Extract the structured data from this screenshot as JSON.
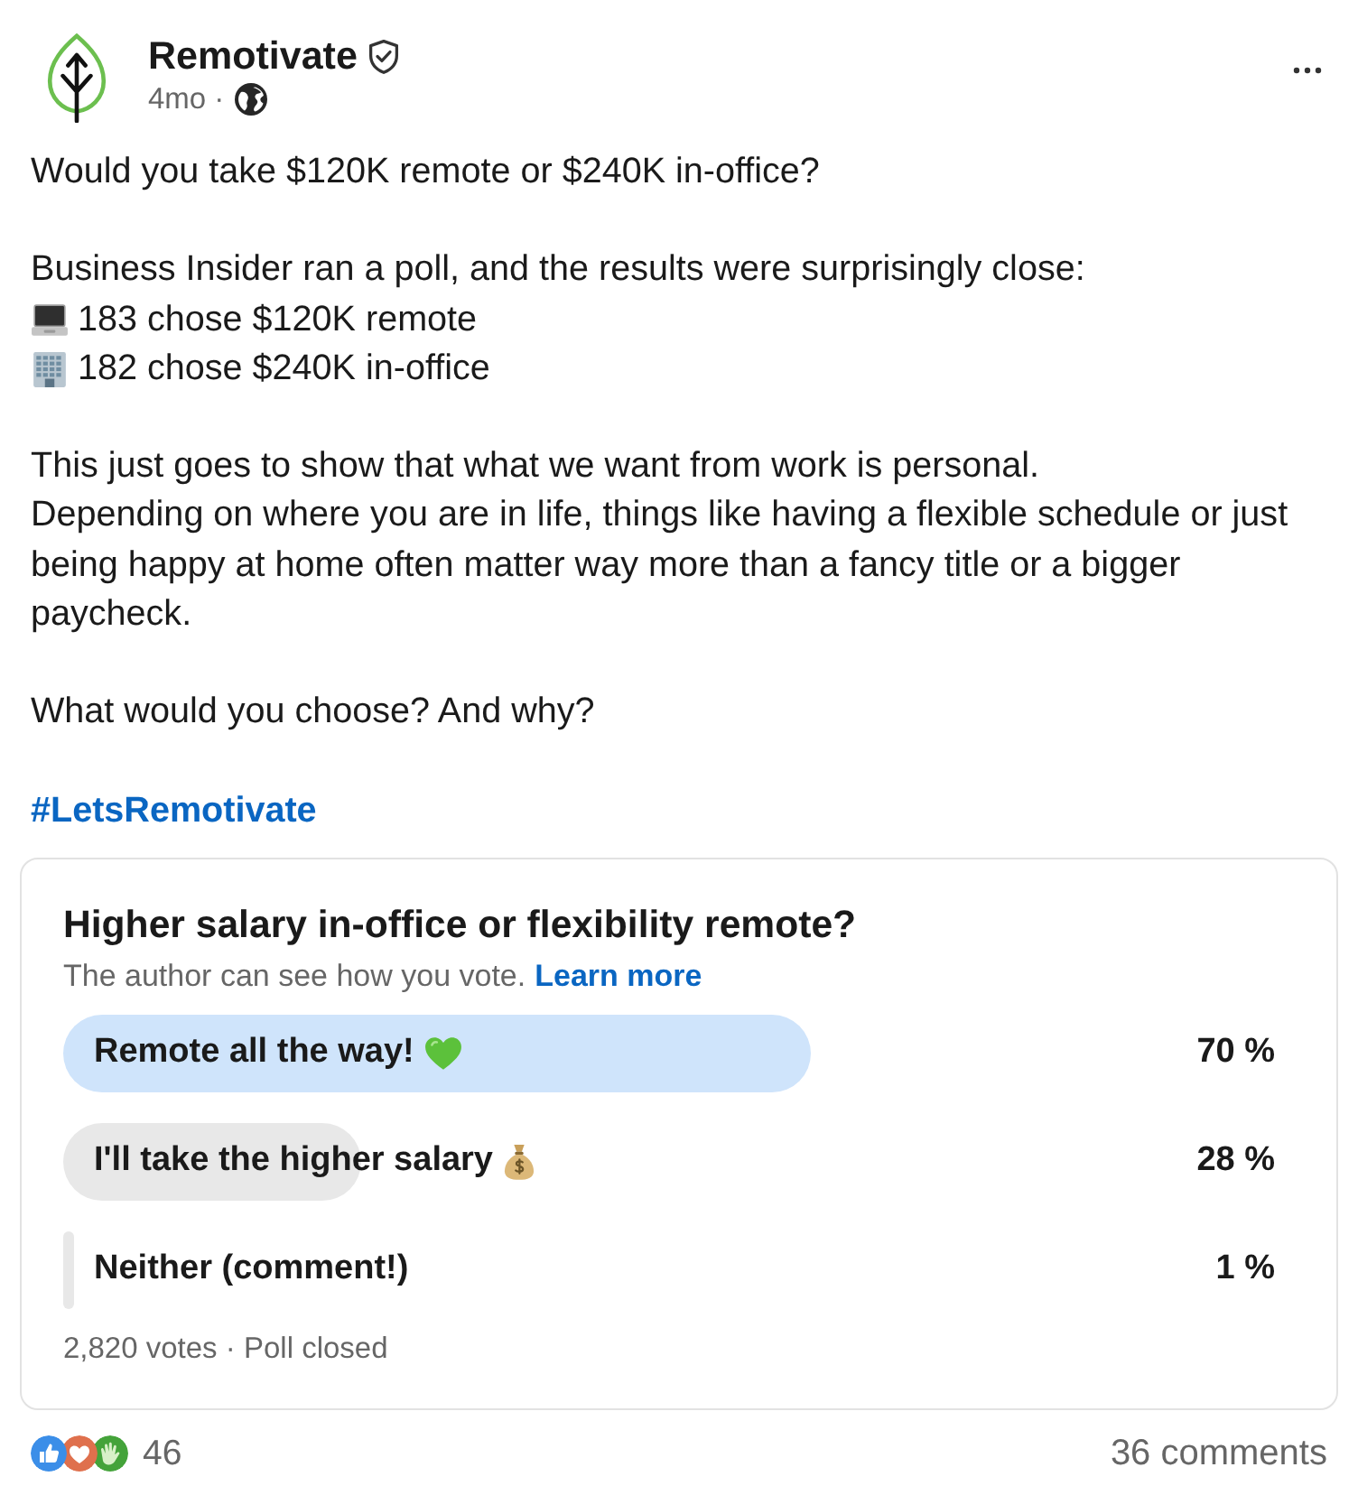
{
  "post": {
    "author": "Remotivate",
    "verified": true,
    "age": "4mo ·",
    "body": [
      {
        "lines": [
          {
            "kind": "text",
            "text": "Would you take $120K remote or $240K in-office?"
          }
        ]
      },
      {
        "lines": [
          {
            "kind": "text",
            "text": "Business Insider ran a poll, and the results were surprisingly close:"
          },
          {
            "kind": "laptop",
            "text": "183 chose $120K remote"
          },
          {
            "kind": "building",
            "text": "182 chose $240K in-office"
          }
        ]
      },
      {
        "lines": [
          {
            "kind": "text",
            "text": "This just goes to show that what we want from work is personal."
          },
          {
            "kind": "text",
            "text": "Depending on where you are in life, things like having a flexible schedule or just being happy at home often matter way more than a fancy title or a bigger paycheck."
          }
        ]
      },
      {
        "lines": [
          {
            "kind": "text",
            "text": "What would you choose? And why?"
          }
        ]
      }
    ],
    "hashtag": "#LetsRemotivate"
  },
  "poll": {
    "question": "Higher salary in-office or flexibility remote?",
    "note": "The author can see how you vote.",
    "note_link": "Learn more",
    "options": [
      {
        "label": "Remote all the way!",
        "kind": "heart",
        "percent": "70 %",
        "level": 0.7,
        "selected": true
      },
      {
        "label": "I'll take the higher salary",
        "kind": "money_bag",
        "percent": "28 %",
        "level": 0.28,
        "selected": false
      },
      {
        "label": "Neither (comment!)",
        "kind": "plain",
        "percent": "1 %",
        "level": 0.01,
        "selected": false
      }
    ],
    "summary": "2,820 votes · Poll closed"
  },
  "social": {
    "reactions": "46",
    "comments": "36 comments"
  }
}
